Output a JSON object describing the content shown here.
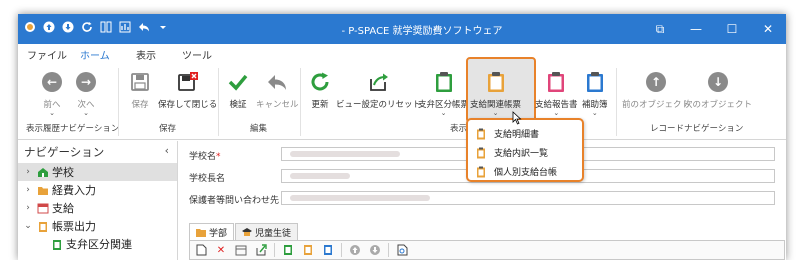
{
  "window": {
    "title": "- P-SPACE 就学奨励費ソフトウェア",
    "controls": {
      "restore": "⧉",
      "minimize": "—",
      "maximize": "☐",
      "close": "✕"
    }
  },
  "quick_access": [
    "app-icon",
    "upload-icon",
    "download-icon",
    "refresh-icon",
    "layout-icon",
    "chart-icon",
    "undo-icon",
    "dropdown-icon"
  ],
  "menu": {
    "tabs": [
      {
        "label": "ファイル",
        "active": false
      },
      {
        "label": "ホーム",
        "active": true
      },
      {
        "label": "表示",
        "active": false
      },
      {
        "label": "ツール",
        "active": false
      }
    ]
  },
  "ribbon": {
    "nav_history": {
      "back": "前へ",
      "forward": "次へ",
      "group": "表示履歴ナビゲーション"
    },
    "save": {
      "save": "保存",
      "save_close": "保存して閉じる",
      "group": "保存"
    },
    "edit": {
      "verify": "検証",
      "cancel": "キャンセル",
      "group": "編集"
    },
    "update": {
      "refresh": "更新",
      "reset_view": "ビュー設定のリセット"
    },
    "reports": {
      "support_category": "支弁区分帳票",
      "support_related": "支給関連帳票",
      "support_report": "支給報告書",
      "subsidy_book": "補助簿",
      "group": "表示"
    },
    "record_nav": {
      "prev_object": "前のオブジェクト",
      "next_object": "次のオブジェクト",
      "group": "レコードナビゲーション"
    },
    "colors": {
      "green": "#2e9e3e",
      "gray": "#8a8a8a",
      "blue": "#2b79d0",
      "highlight": "#e8822a"
    }
  },
  "dropdown": {
    "items": [
      {
        "label": "支給明細書"
      },
      {
        "label": "支給内訳一覧"
      },
      {
        "label": "個人別支給台帳"
      }
    ]
  },
  "navigation": {
    "title": "ナビゲーション",
    "collapse": "‹",
    "items": [
      {
        "label": "学校",
        "arrow": "›",
        "icon": "school-icon",
        "selected": true
      },
      {
        "label": "経費入力",
        "arrow": "›",
        "icon": "folder-icon",
        "selected": false
      },
      {
        "label": "支給",
        "arrow": "›",
        "icon": "calendar-icon",
        "selected": false
      },
      {
        "label": "帳票出力",
        "arrow": "⌄",
        "icon": "report-icon",
        "selected": false
      },
      {
        "label": "支弁区分関連",
        "arrow": "",
        "icon": "report-icon",
        "selected": false
      }
    ]
  },
  "form": {
    "fields": [
      {
        "label": "学校名",
        "required": true,
        "value": ""
      },
      {
        "label": "学校長名",
        "required": false,
        "value": ""
      },
      {
        "label": "保護者等問い合わせ先",
        "required": false,
        "value": ""
      }
    ],
    "required_mark": "*",
    "subtabs": [
      {
        "label": "学部",
        "active": true
      },
      {
        "label": "児童生徒",
        "active": false
      }
    ]
  }
}
